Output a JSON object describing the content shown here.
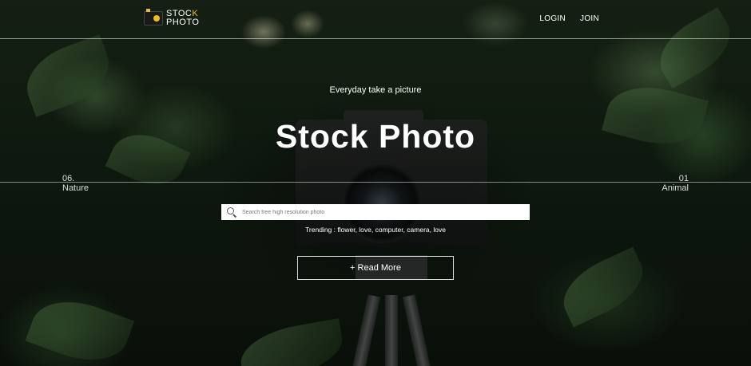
{
  "logo": {
    "line1": "STOC",
    "line1_accent": "K",
    "line2": "PHOTO"
  },
  "nav": {
    "login": "LOGIN",
    "join": "JOIN"
  },
  "hero": {
    "tagline": "Everyday take a picture",
    "title": "Stock Photo",
    "left_slide": {
      "number": "06.",
      "label": "Nature"
    },
    "right_slide": {
      "number": "01",
      "label": "Animal"
    },
    "search_placeholder": "Search free high resolution photo",
    "trending": "Trending : flower, love, computer, camera, love",
    "read_more": "+ Read More"
  },
  "colors": {
    "accent": "#e8c21c",
    "text": "#ffffff",
    "search_bg": "#ffffff"
  },
  "icons": [
    "camera-logo-icon",
    "search-icon"
  ]
}
